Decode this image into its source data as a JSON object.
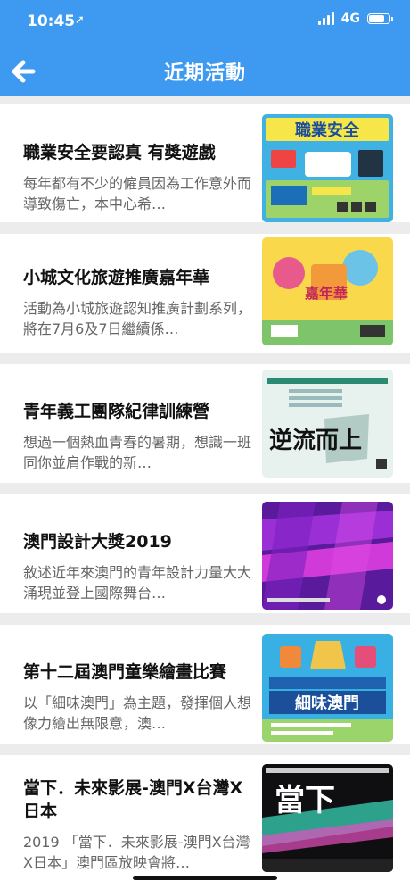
{
  "status": {
    "time": "10:45",
    "network": "4G",
    "battery_percent": 75
  },
  "header": {
    "title": "近期活動"
  },
  "events": [
    {
      "title": "職業安全要認真 有獎遊戲",
      "desc": "每年都有不少的僱員因為工作意外而導致傷亡，本中心希…",
      "thumb_text": "職業安全"
    },
    {
      "title": "小城文化旅遊推廣嘉年華",
      "desc": "活動為小城旅遊認知推廣計劃系列，將在7月6及7日繼續係…",
      "thumb_text": "嘉年華"
    },
    {
      "title": "青年義工團隊紀律訓練營",
      "desc": "想過一個熱血青春的暑期，想識一班同你並肩作戰的新…",
      "thumb_text": "逆流而上"
    },
    {
      "title": "澳門設計大獎2019",
      "desc": "敘述近年來澳門的青年設計力量大大涌現並登上國際舞台…",
      "thumb_text": ""
    },
    {
      "title": "第十二屆澳門童樂繪畫比賽",
      "desc": "以「細味澳門」為主題，發揮個人想像力繪出無限意，澳…",
      "thumb_text": "細味澳門"
    },
    {
      "title": "當下．未來影展-澳門X台灣X日本",
      "desc": "2019 「當下．未來影展-澳門X台灣X日本」澳門區放映會將…",
      "thumb_text": "當下"
    }
  ]
}
